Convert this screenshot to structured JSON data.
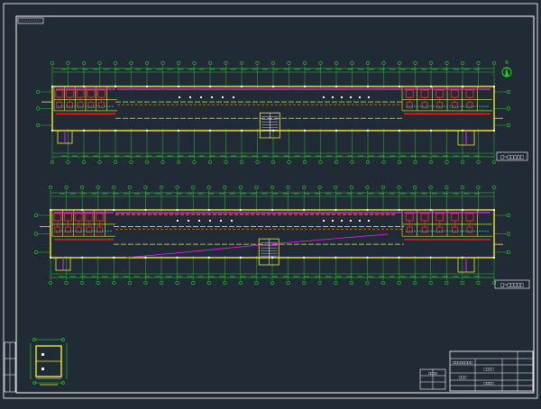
{
  "drawing": {
    "colors": {
      "background": "#202b36",
      "frame": "#ffffff",
      "axis": "#22dd22",
      "wall": "#eeee33",
      "pipe_red": "#ff2222",
      "pipe_magenta": "#ee22ee",
      "pipe_cyan": "#22eeee",
      "pipe_orange": "#ff8800",
      "dim": "#33dd33"
    },
    "plans": [
      {
        "id": "upper",
        "label": "□~□□□□□"
      },
      {
        "id": "lower",
        "label": "□~□□□□□"
      }
    ],
    "north_arrow": {
      "letter": "N"
    },
    "titleblock": {
      "cells": [
        "□□□□□□□□",
        "□□□□",
        "□□□",
        "□□□□"
      ]
    },
    "stamp": {
      "label": "□□□□"
    }
  }
}
